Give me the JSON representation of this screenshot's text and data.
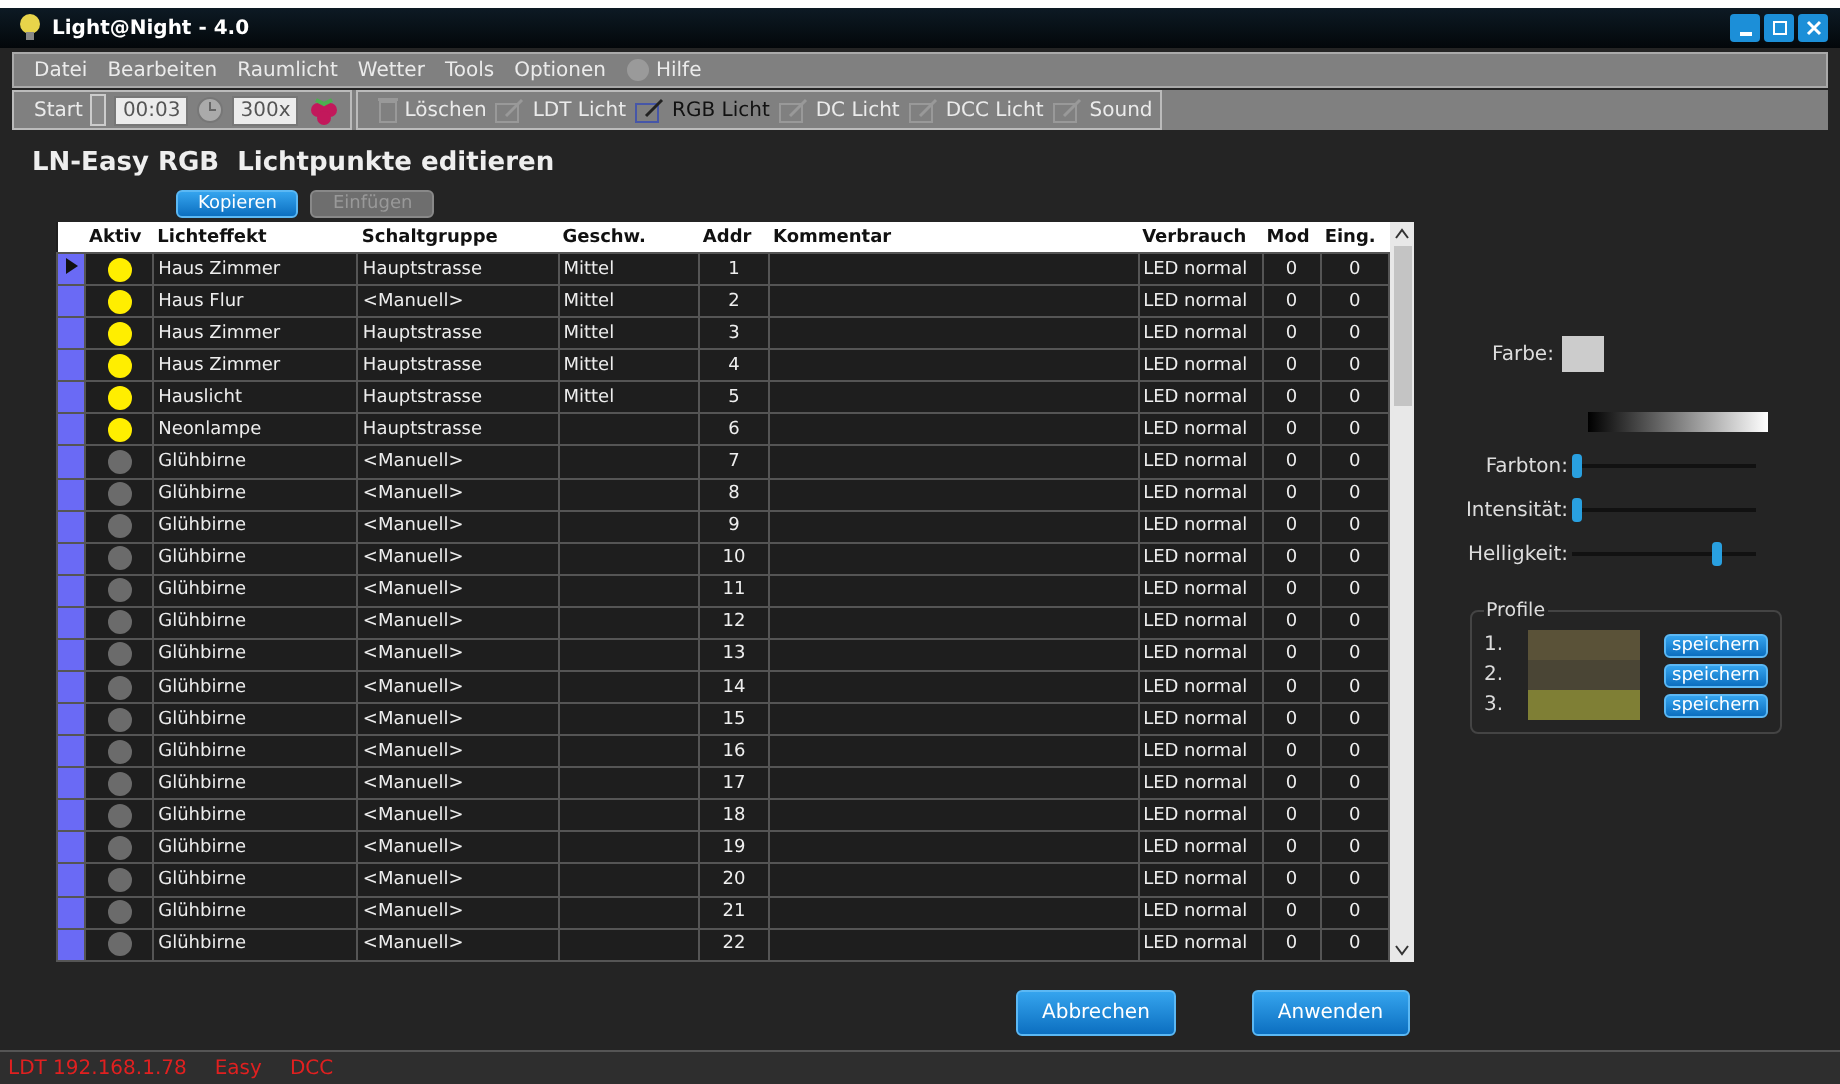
{
  "window": {
    "title": "Light@Night - 4.0"
  },
  "menu": [
    {
      "label": "Datei",
      "disabled": true
    },
    {
      "label": "Bearbeiten",
      "disabled": true
    },
    {
      "label": "Raumlicht",
      "disabled": true
    },
    {
      "label": "Wetter",
      "disabled": true
    },
    {
      "label": "Tools",
      "disabled": true
    },
    {
      "label": "Optionen",
      "disabled": true
    },
    {
      "label": "Hilfe",
      "disabled": true,
      "kind": "help"
    }
  ],
  "toolbar": {
    "start": {
      "label": "Start",
      "disabled": true
    },
    "time": "00:03",
    "speed": "300x",
    "tools": [
      {
        "label": "Löschen",
        "kind": "delete",
        "selected": false
      },
      {
        "label": "LDT Licht",
        "kind": "edit",
        "selected": false
      },
      {
        "label": "RGB Licht",
        "kind": "edit",
        "selected": true
      },
      {
        "label": "DC Licht",
        "kind": "edit",
        "selected": false
      },
      {
        "label": "DCC Licht",
        "kind": "edit",
        "selected": false
      },
      {
        "label": "Sound",
        "kind": "edit",
        "selected": false
      }
    ]
  },
  "heading": "LN-Easy RGB  Lichtpunkte editieren",
  "actions": [
    {
      "label": "Kopieren",
      "disabled": false
    },
    {
      "label": "Einfügen",
      "disabled": true
    }
  ],
  "table": {
    "columns": [
      "Aktiv",
      "Lichteffekt",
      "Schaltgruppe",
      "Geschw.",
      "Addr",
      "Kommentar",
      "Verbrauch",
      "Mod",
      "Eing."
    ],
    "rows": [
      {
        "current": true,
        "on": true,
        "effect": "Haus Zimmer",
        "group": "Hauptstrasse",
        "speed": "Mittel",
        "addr": "1",
        "usage": "LED normal",
        "mod": "0",
        "input": "0"
      },
      {
        "current": false,
        "on": true,
        "effect": "Haus Flur",
        "group": "<Manuell>",
        "speed": "Mittel",
        "addr": "2",
        "usage": "LED normal",
        "mod": "0",
        "input": "0"
      },
      {
        "current": false,
        "on": true,
        "effect": "Haus Zimmer",
        "group": "Hauptstrasse",
        "speed": "Mittel",
        "addr": "3",
        "usage": "LED normal",
        "mod": "0",
        "input": "0"
      },
      {
        "current": false,
        "on": true,
        "effect": "Haus Zimmer",
        "group": "Hauptstrasse",
        "speed": "Mittel",
        "addr": "4",
        "usage": "LED normal",
        "mod": "0",
        "input": "0"
      },
      {
        "current": false,
        "on": true,
        "effect": "Hauslicht",
        "group": "Hauptstrasse",
        "speed": "Mittel",
        "addr": "5",
        "usage": "LED normal",
        "mod": "0",
        "input": "0"
      },
      {
        "current": false,
        "on": true,
        "effect": "Neonlampe",
        "group": "Hauptstrasse",
        "addr": "6",
        "usage": "LED normal",
        "mod": "0",
        "input": "0"
      },
      {
        "current": false,
        "on": false,
        "effect": "Glühbirne",
        "group": "<Manuell>",
        "addr": "7",
        "usage": "LED normal",
        "mod": "0",
        "input": "0"
      },
      {
        "current": false,
        "on": false,
        "effect": "Glühbirne",
        "group": "<Manuell>",
        "addr": "8",
        "usage": "LED normal",
        "mod": "0",
        "input": "0"
      },
      {
        "current": false,
        "on": false,
        "effect": "Glühbirne",
        "group": "<Manuell>",
        "addr": "9",
        "usage": "LED normal",
        "mod": "0",
        "input": "0"
      },
      {
        "current": false,
        "on": false,
        "effect": "Glühbirne",
        "group": "<Manuell>",
        "addr": "10",
        "usage": "LED normal",
        "mod": "0",
        "input": "0"
      },
      {
        "current": false,
        "on": false,
        "effect": "Glühbirne",
        "group": "<Manuell>",
        "addr": "11",
        "usage": "LED normal",
        "mod": "0",
        "input": "0"
      },
      {
        "current": false,
        "on": false,
        "effect": "Glühbirne",
        "group": "<Manuell>",
        "addr": "12",
        "usage": "LED normal",
        "mod": "0",
        "input": "0"
      },
      {
        "current": false,
        "on": false,
        "effect": "Glühbirne",
        "group": "<Manuell>",
        "addr": "13",
        "usage": "LED normal",
        "mod": "0",
        "input": "0"
      },
      {
        "current": false,
        "on": false,
        "effect": "Glühbirne",
        "group": "<Manuell>",
        "addr": "14",
        "usage": "LED normal",
        "mod": "0",
        "input": "0"
      },
      {
        "current": false,
        "on": false,
        "effect": "Glühbirne",
        "group": "<Manuell>",
        "addr": "15",
        "usage": "LED normal",
        "mod": "0",
        "input": "0"
      },
      {
        "current": false,
        "on": false,
        "effect": "Glühbirne",
        "group": "<Manuell>",
        "addr": "16",
        "usage": "LED normal",
        "mod": "0",
        "input": "0"
      },
      {
        "current": false,
        "on": false,
        "effect": "Glühbirne",
        "group": "<Manuell>",
        "addr": "17",
        "usage": "LED normal",
        "mod": "0",
        "input": "0"
      },
      {
        "current": false,
        "on": false,
        "effect": "Glühbirne",
        "group": "<Manuell>",
        "addr": "18",
        "usage": "LED normal",
        "mod": "0",
        "input": "0"
      },
      {
        "current": false,
        "on": false,
        "effect": "Glühbirne",
        "group": "<Manuell>",
        "addr": "19",
        "usage": "LED normal",
        "mod": "0",
        "input": "0"
      },
      {
        "current": false,
        "on": false,
        "effect": "Glühbirne",
        "group": "<Manuell>",
        "addr": "20",
        "usage": "LED normal",
        "mod": "0",
        "input": "0"
      },
      {
        "current": false,
        "on": false,
        "effect": "Glühbirne",
        "group": "<Manuell>",
        "addr": "21",
        "usage": "LED normal",
        "mod": "0",
        "input": "0"
      },
      {
        "current": false,
        "on": false,
        "effect": "Glühbirne",
        "group": "<Manuell>",
        "addr": "22",
        "usage": "LED normal",
        "mod": "0",
        "input": "0"
      }
    ]
  },
  "color_panel": {
    "label": "Farbe:",
    "sliders": [
      {
        "label": "Farbton:",
        "level": 0.0
      },
      {
        "label": "Intensität:",
        "level": 0.0
      },
      {
        "label": "Helligkeit:",
        "level": 0.8
      }
    ],
    "profiles": {
      "title": "Profile",
      "items": [
        {
          "number": "1.",
          "color": "#5a5238",
          "button": "speichern"
        },
        {
          "number": "2.",
          "color": "#4a4535",
          "button": "speichern"
        },
        {
          "number": "3.",
          "color": "#7f7f35",
          "button": "speichern"
        }
      ]
    }
  },
  "buttons": [
    "Abbrechen",
    "Anwenden"
  ],
  "status_bar": [
    "LDT 192.168.1.78",
    "Easy",
    "DCC"
  ]
}
